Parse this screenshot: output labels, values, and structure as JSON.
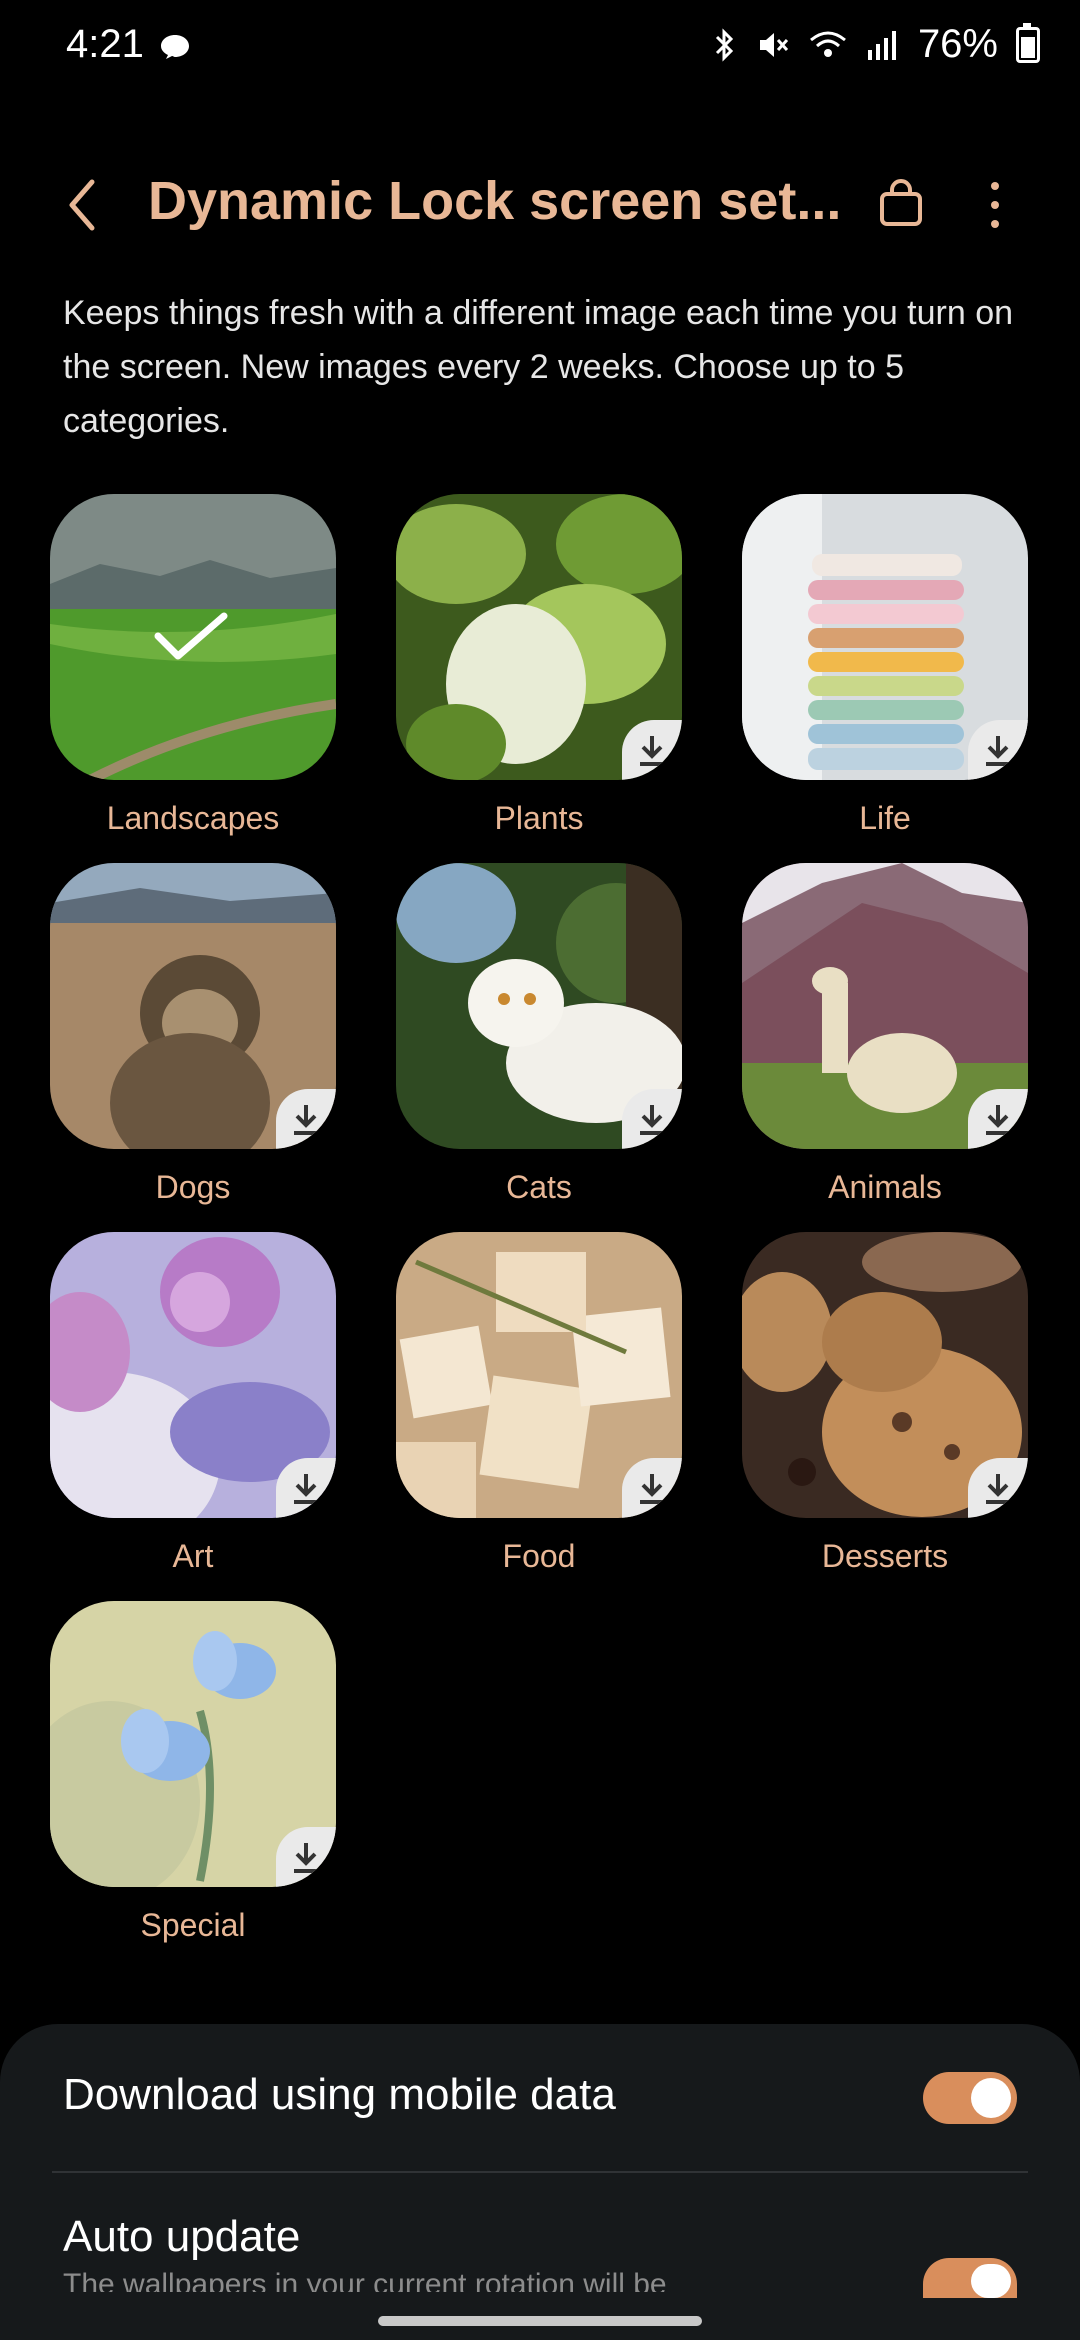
{
  "status_bar": {
    "time": "4:21",
    "battery": "76%"
  },
  "header": {
    "title": "Dynamic Lock screen set..."
  },
  "description": "Keeps things fresh with a different image each time you turn on the screen. New images every 2 weeks. Choose up to 5 categories.",
  "categories": [
    {
      "label": "Landscapes",
      "selected": true
    },
    {
      "label": "Plants",
      "downloadable": true
    },
    {
      "label": "Life",
      "downloadable": true
    },
    {
      "label": "Dogs",
      "downloadable": true
    },
    {
      "label": "Cats",
      "downloadable": true
    },
    {
      "label": "Animals",
      "downloadable": true
    },
    {
      "label": "Art",
      "downloadable": true
    },
    {
      "label": "Food",
      "downloadable": true
    },
    {
      "label": "Desserts",
      "downloadable": true
    },
    {
      "label": "Special",
      "downloadable": true
    }
  ],
  "settings": {
    "mobile_data": {
      "label": "Download using mobile data",
      "on": true
    },
    "auto_update": {
      "label": "Auto update",
      "sub": "The wallpapers in your current rotation will be",
      "on": true
    }
  },
  "colors": {
    "accent": "#e8b796",
    "toggle": "#d98e5c",
    "sheet": "#16191b"
  }
}
